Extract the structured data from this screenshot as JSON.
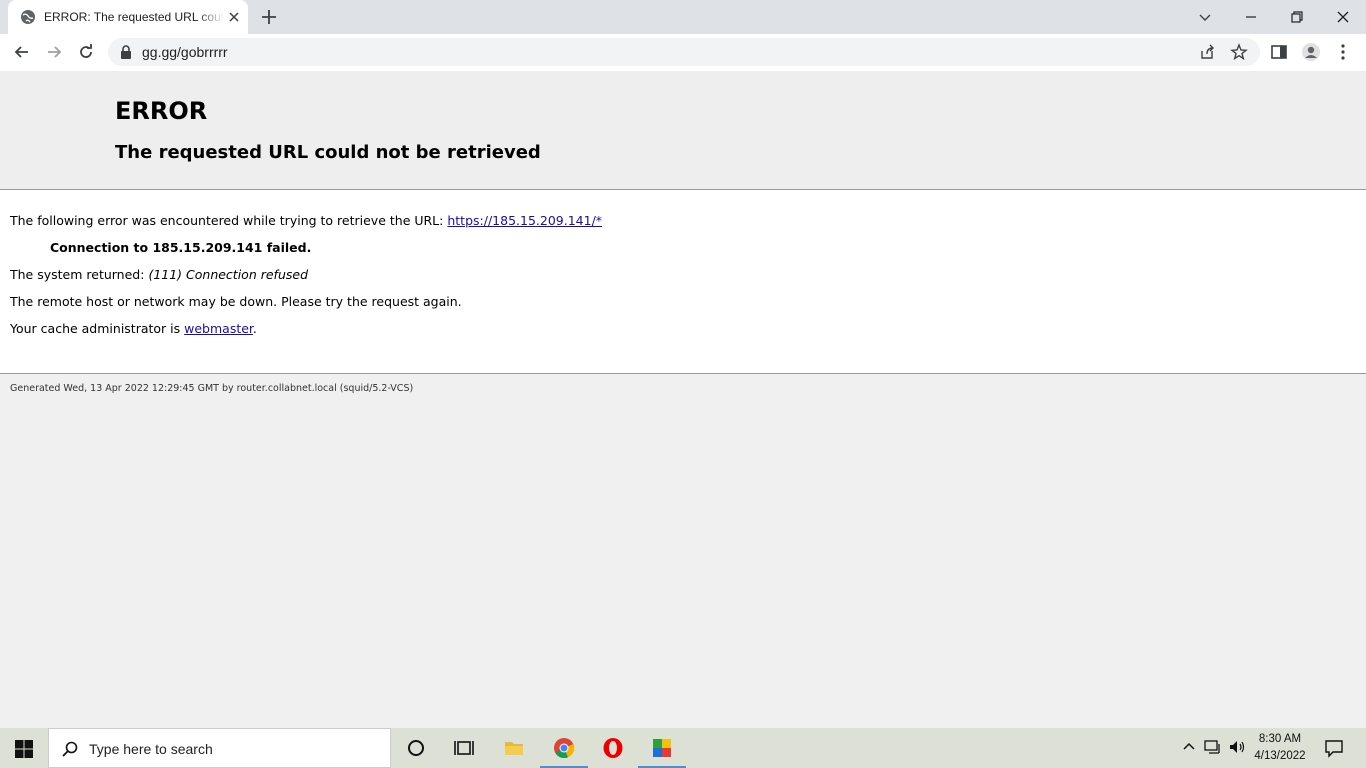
{
  "browser": {
    "tab": {
      "title": "ERROR: The requested URL could not be retrieved"
    },
    "address_bar": {
      "url": "gg.gg/gobrrrrr"
    }
  },
  "page": {
    "heading": "ERROR",
    "subheading": "The requested URL could not be retrieved",
    "intro_text": "The following error was encountered while trying to retrieve the URL:",
    "url_link": "https://185.15.209.141/*",
    "error_detail": "Connection to 185.15.209.141 failed.",
    "system_returned_label": "The system returned:",
    "system_returned_value": "(111) Connection refused",
    "advice": "The remote host or network may be down. Please try the request again.",
    "cache_admin_label": "Your cache administrator is",
    "cache_admin_link": "webmaster",
    "cache_admin_suffix": ".",
    "footer": "Generated Wed, 13 Apr 2022 12:29:45 GMT by router.collabnet.local (squid/5.2-VCS)"
  },
  "taskbar": {
    "search_placeholder": "Type here to search",
    "time": "8:30 AM",
    "date": "4/13/2022"
  },
  "colors": {
    "link": "#1a0dab",
    "taskbar": "#dde0d4",
    "tabbar": "#dee1e6"
  }
}
